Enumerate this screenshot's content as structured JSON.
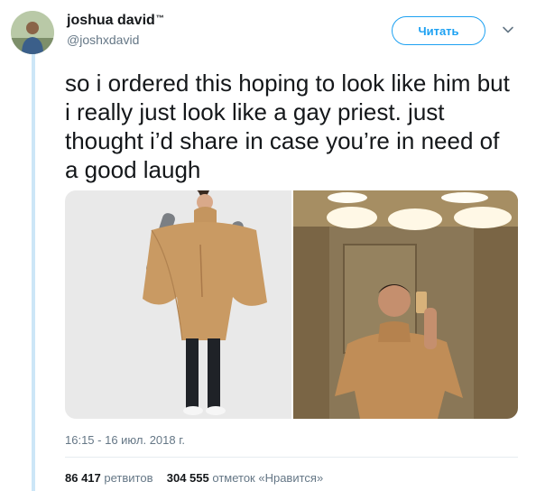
{
  "colors": {
    "accent": "#1da1f2",
    "thread_line": "#cce6f7",
    "muted_text": "#657786",
    "primary_text": "#14171a",
    "poncho": "#c4955f"
  },
  "author": {
    "display_name": "joshua david",
    "verified_mark": "™",
    "handle": "@joshxdavid"
  },
  "header": {
    "follow_label": "Читать",
    "more_icon": "chevron-down-icon"
  },
  "tweet": {
    "text": "so i ordered this hoping to look like him but i really just look like a gay priest. just thought i’d share in case you’re in need of a good laugh",
    "timestamp": "16:15 - 16 июл. 2018 г."
  },
  "stats": {
    "retweets_count": "86 417",
    "retweets_label": "ретвитов",
    "likes_count": "304 555",
    "likes_label": "отметок «Нравится»"
  }
}
